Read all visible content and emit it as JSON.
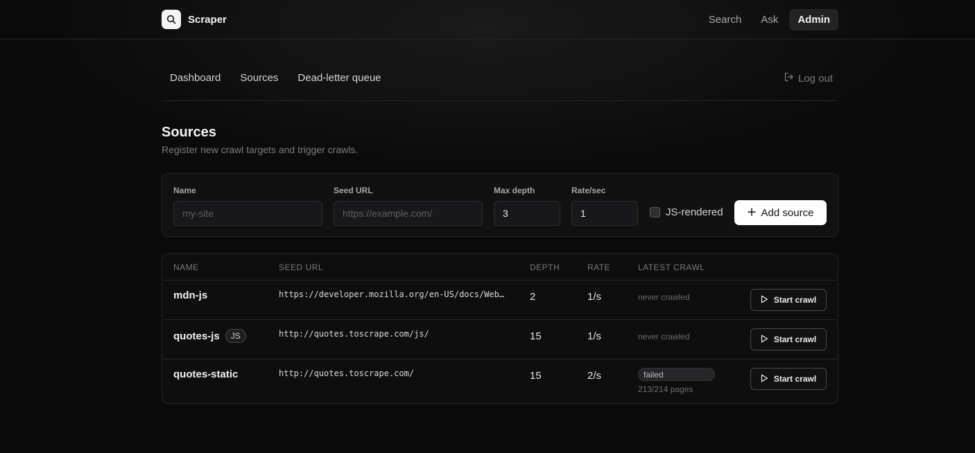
{
  "app": {
    "name": "Scraper",
    "logo_icon": "search-icon"
  },
  "topnav": {
    "items": [
      {
        "label": "Search",
        "active": false
      },
      {
        "label": "Ask",
        "active": false
      },
      {
        "label": "Admin",
        "active": true
      }
    ]
  },
  "subnav": {
    "links": [
      "Dashboard",
      "Sources",
      "Dead-letter queue"
    ],
    "logout_label": "Log out"
  },
  "page": {
    "title": "Sources",
    "subtitle": "Register new crawl targets and trigger crawls."
  },
  "form": {
    "name": {
      "label": "Name",
      "placeholder": "my-site",
      "value": ""
    },
    "seed_url": {
      "label": "Seed URL",
      "placeholder": "https://example.com/",
      "value": ""
    },
    "max_depth": {
      "label": "Max depth",
      "value": "3"
    },
    "rate": {
      "label": "Rate/sec",
      "value": "1"
    },
    "js_rendered_label": "JS-rendered",
    "add_button_label": "Add source"
  },
  "table": {
    "columns": [
      "NAME",
      "SEED URL",
      "DEPTH",
      "RATE",
      "LATEST CRAWL"
    ],
    "rows": [
      {
        "name": "mdn-js",
        "js_badge": "",
        "seed_url": "https://developer.mozilla.org/en-US/docs/Web…",
        "depth": "2",
        "rate": "1/s",
        "crawl_status": "never crawled",
        "crawl_pages": "",
        "action": "Start crawl"
      },
      {
        "name": "quotes-js",
        "js_badge": "JS",
        "seed_url": "http://quotes.toscrape.com/js/",
        "depth": "15",
        "rate": "1/s",
        "crawl_status": "never crawled",
        "crawl_pages": "",
        "action": "Start crawl"
      },
      {
        "name": "quotes-static",
        "js_badge": "",
        "seed_url": "http://quotes.toscrape.com/",
        "depth": "15",
        "rate": "2/s",
        "crawl_status": "failed",
        "crawl_pages": "213/214 pages",
        "action": "Start crawl"
      }
    ]
  },
  "colors": {
    "background": "#0b0b0c",
    "card": "#111112",
    "border": "#27272a",
    "primary_button": "#ffffff"
  }
}
